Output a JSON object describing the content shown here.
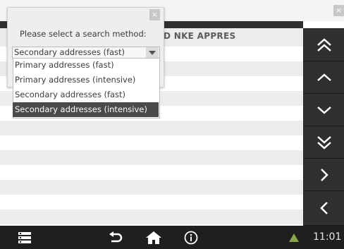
{
  "table": {
    "header_text": "D  NKE  APPRES",
    "row_count": 12
  },
  "dialog": {
    "prompt": "Please select a search method:",
    "close_symbol": "×",
    "selected_value": "Secondary addresses (fast)",
    "options": [
      "Primary addresses (fast)",
      "Primary addresses (intensive)",
      "Secondary addresses (fast)",
      "Secondary addresses (intensive)"
    ],
    "highlighted_option_index": 3
  },
  "window": {
    "close_symbol": "×"
  },
  "nav": {
    "buttons": [
      "double-chevron-up-icon",
      "chevron-up-icon",
      "chevron-down-icon",
      "double-chevron-down-icon",
      "chevron-right-icon",
      "chevron-left-icon"
    ]
  },
  "taskbar": {
    "clock": "11:01",
    "icons": [
      "menu-icon",
      "back-icon",
      "home-icon",
      "info-icon",
      "warning-icon"
    ]
  },
  "colors": {
    "nav_bg": "#303030",
    "taskbar_bg": "#1f1f1f",
    "row_alt": "#ececec",
    "highlight": "#4a4a4a",
    "warning": "#8aa64a"
  }
}
